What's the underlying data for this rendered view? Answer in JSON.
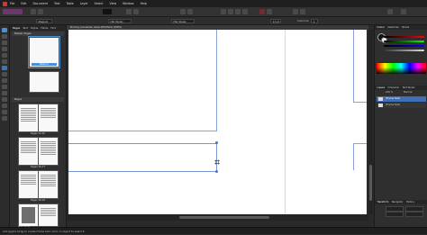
{
  "menubar": {
    "items": [
      "Affinity Publisher",
      "File",
      "Edit",
      "Document",
      "Text",
      "Table",
      "Layer",
      "Select",
      "View",
      "Window",
      "Help"
    ]
  },
  "context_toolbar": {
    "style_value": "Magnet",
    "font_label": "[No Style]",
    "font2_label": "[No Style]",
    "size_value": "11 pt",
    "columns_label": "Columns:",
    "columns_value": "1"
  },
  "pages_panel": {
    "tabs": [
      "Pages",
      "Text",
      "Styles",
      "Fields",
      "Find"
    ],
    "master_section": "Master Pages",
    "pages_section": "Pages",
    "master_label": "Master A",
    "spreads": [
      "Pages 24-25",
      "Pages 26-27",
      "Pages 28-29",
      "Pages 30-31"
    ]
  },
  "document": {
    "tab_title": "Proving yourselves: issue (Modified) (100%)"
  },
  "right_panel": {
    "top_tabs": [
      "Colour",
      "Swatches",
      "Stroke"
    ],
    "layers_tabs": [
      "Layers",
      "Character",
      "Text Styles"
    ],
    "opacity_label": "100 %",
    "blend_label": "Normal",
    "layers": [
      "(Frame Text)",
      "(Frame Text)"
    ],
    "bottom_tabs": [
      "Transform",
      "Navigator",
      "History"
    ]
  },
  "statusbar": {
    "text": "Add glyphs  Drag to create Frame text. Click on object to select it."
  },
  "colors": {
    "accent": "#4a90d9",
    "background": "#2a2a2a",
    "page": "#ffffff"
  }
}
